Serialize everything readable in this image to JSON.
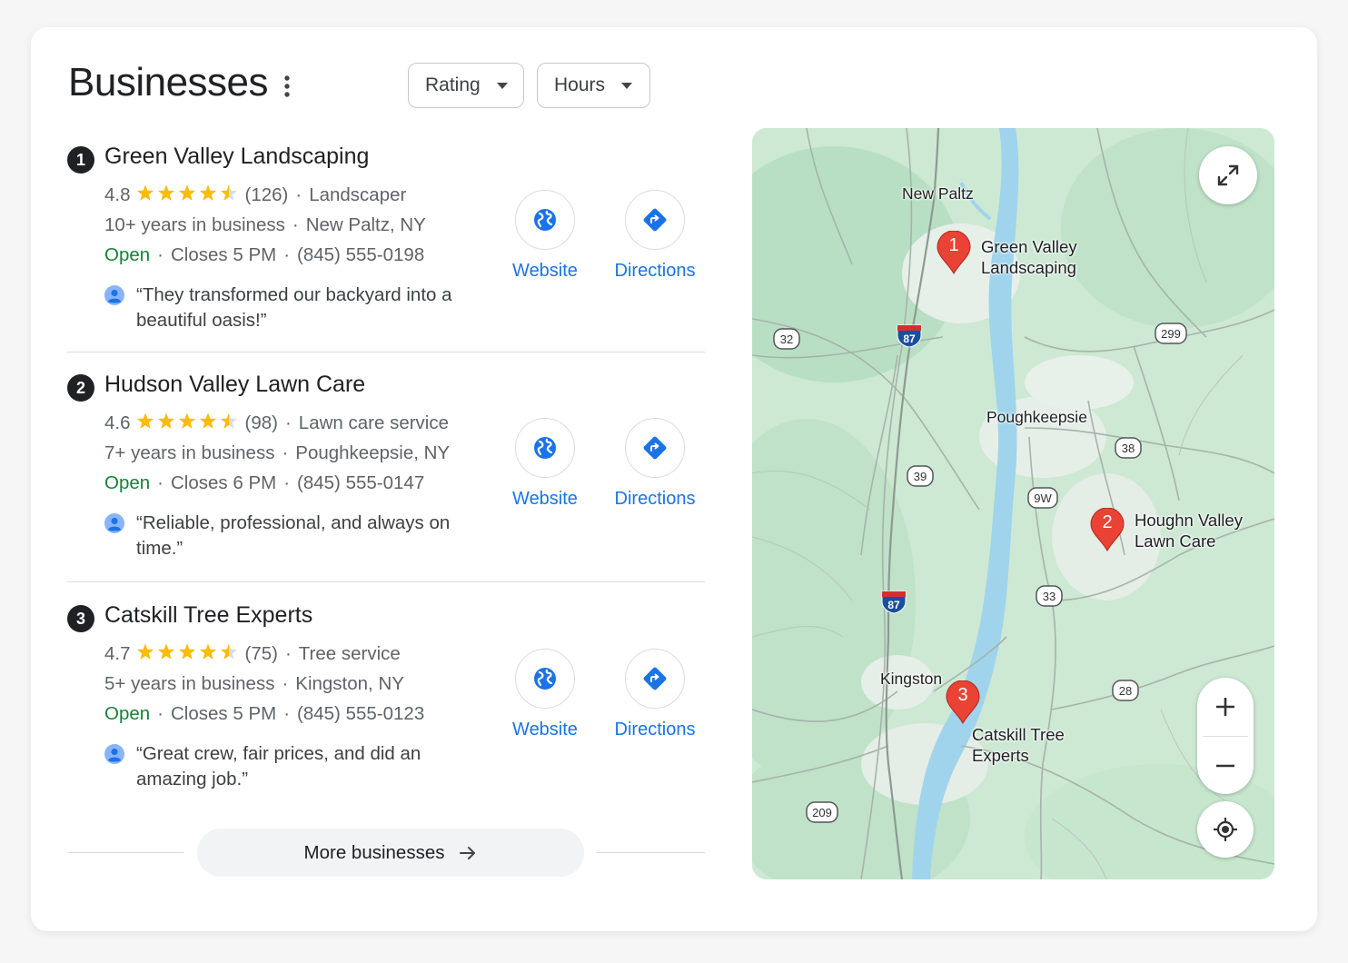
{
  "header": {
    "title": "Businesses",
    "filters": [
      {
        "label": "Rating"
      },
      {
        "label": "Hours"
      }
    ]
  },
  "businesses": [
    {
      "number": "1",
      "name": "Green Valley Landscaping",
      "rating": "4.8",
      "stars": 4.8,
      "reviews": "(126)",
      "category": "Landscaper",
      "years": "10+ years in business",
      "location": "New Paltz, NY",
      "status": "Open",
      "closes": "Closes 5 PM",
      "phone": "(845) 555-0198",
      "review": "“They transformed our backyard into a beautiful oasis!”",
      "website_label": "Website",
      "directions_label": "Directions"
    },
    {
      "number": "2",
      "name": "Hudson Valley Lawn Care",
      "rating": "4.6",
      "stars": 4.6,
      "reviews": "(98)",
      "category": "Lawn care service",
      "years": "7+ years in business",
      "location": "Poughkeepsie, NY",
      "status": "Open",
      "closes": "Closes 6 PM",
      "phone": "(845) 555-0147",
      "review": "“Reliable, professional, and always on time.”",
      "website_label": "Website",
      "directions_label": "Directions"
    },
    {
      "number": "3",
      "name": "Catskill Tree Experts",
      "rating": "4.7",
      "stars": 4.7,
      "reviews": "(75)",
      "category": "Tree service",
      "years": "5+ years in business",
      "location": "Kingston, NY",
      "status": "Open",
      "closes": "Closes 5 PM",
      "phone": "(845) 555-0123",
      "review": "“Great crew, fair prices, and did an amazing job.”",
      "website_label": "Website",
      "directions_label": "Directions"
    }
  ],
  "more_button": "More businesses",
  "map": {
    "places": {
      "new_paltz": "New Paltz",
      "poughkeepsie": "Poughkeepsie",
      "kingston": "Kingston"
    },
    "pins": [
      {
        "number": "1",
        "label_line1": "Green Valley",
        "label_line2": "Landscaping"
      },
      {
        "number": "2",
        "label_line1": "Houghn Valley",
        "label_line2": "Lawn Care"
      },
      {
        "number": "3",
        "label_line1": "Catskill Tree",
        "label_line2": "Experts"
      }
    ],
    "routes": [
      "32",
      "87",
      "299",
      "38",
      "39",
      "9W",
      "87",
      "33",
      "28",
      "209"
    ]
  },
  "colors": {
    "accent": "#1a73e8",
    "open": "#188038",
    "star": "#fbbc04",
    "pin": "#ea4335",
    "water": "#9fd4ec"
  }
}
